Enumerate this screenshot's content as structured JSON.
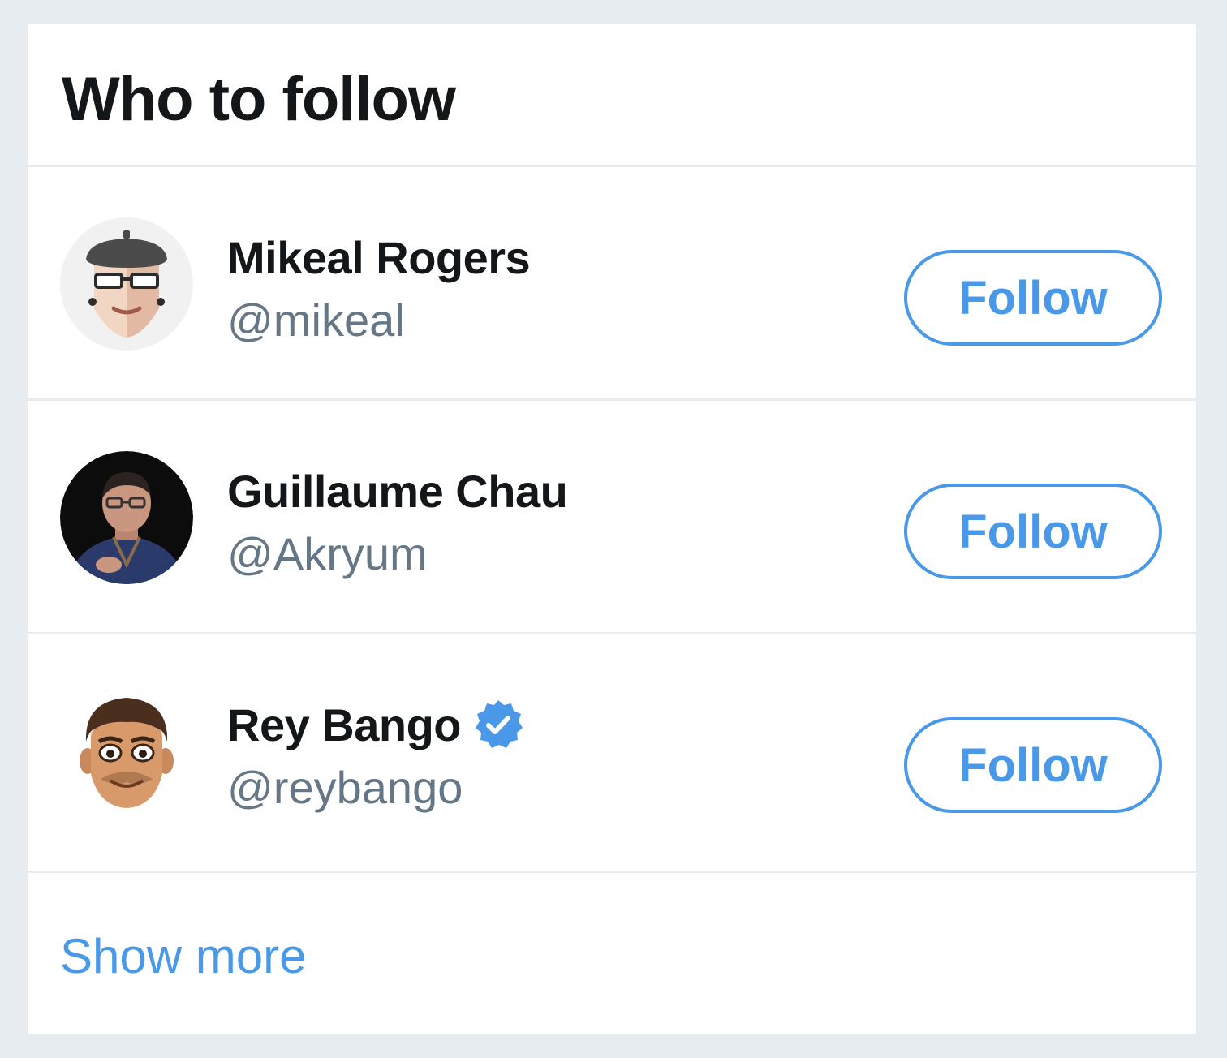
{
  "widget": {
    "title": "Who to follow",
    "show_more_label": "Show more"
  },
  "users": [
    {
      "name": "Mikeal Rogers",
      "handle": "@mikeal",
      "verified": false,
      "follow_label": "Follow"
    },
    {
      "name": "Guillaume Chau",
      "handle": "@Akryum",
      "verified": false,
      "follow_label": "Follow"
    },
    {
      "name": "Rey Bango",
      "handle": "@reybango",
      "verified": true,
      "follow_label": "Follow"
    }
  ],
  "colors": {
    "accent": "#4a99e9",
    "page_background": "#e6ecf0",
    "text_primary": "#14171a",
    "text_secondary": "#657786"
  }
}
